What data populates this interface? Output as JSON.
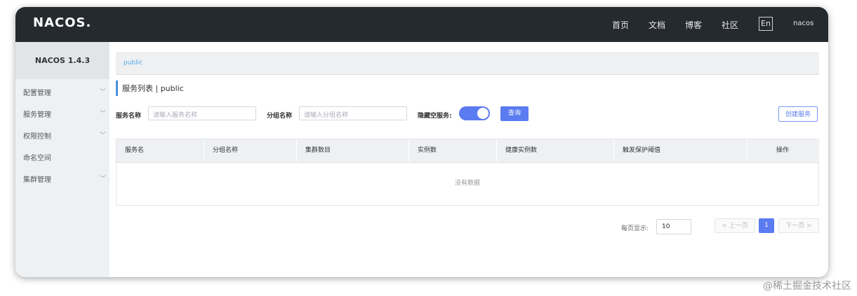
{
  "header": {
    "logo": "NACOS.",
    "nav": [
      "首页",
      "文档",
      "博客",
      "社区"
    ],
    "lang": "En",
    "user": "nacos"
  },
  "sidebar": {
    "version": "NACOS 1.4.3",
    "items": [
      {
        "label": "配置管理",
        "has_chevron": true
      },
      {
        "label": "服务管理",
        "has_chevron": true
      },
      {
        "label": "权限控制",
        "has_chevron": true
      },
      {
        "label": "命名空间",
        "has_chevron": false
      },
      {
        "label": "集群管理",
        "has_chevron": true
      }
    ]
  },
  "main": {
    "breadcrumb": "public",
    "title": "服务列表  |  public",
    "filters": {
      "service_label": "服务名称",
      "service_placeholder": "请输入服务名称",
      "group_label": "分组名称",
      "group_placeholder": "请输入分组名称",
      "hide_empty_label": "隐藏空服务:",
      "hide_empty_on": true,
      "search_button": "查询",
      "create_button": "创建服务"
    },
    "table": {
      "columns": [
        "服务名",
        "分组名称",
        "集群数目",
        "实例数",
        "健康实例数",
        "触发保护阈值",
        "操作"
      ],
      "empty_text": "没有数据"
    },
    "pagination": {
      "per_page_label": "每页显示:",
      "per_page_value": "10",
      "prev": "上一页",
      "current_page": "1",
      "next": "下一页"
    }
  },
  "watermark": "@稀土掘金技术社区",
  "colors": {
    "topbar": "#252a2f",
    "accent": "#5b7bf0",
    "link": "#54a8e3",
    "sidebar_bg": "#eef1f4"
  }
}
